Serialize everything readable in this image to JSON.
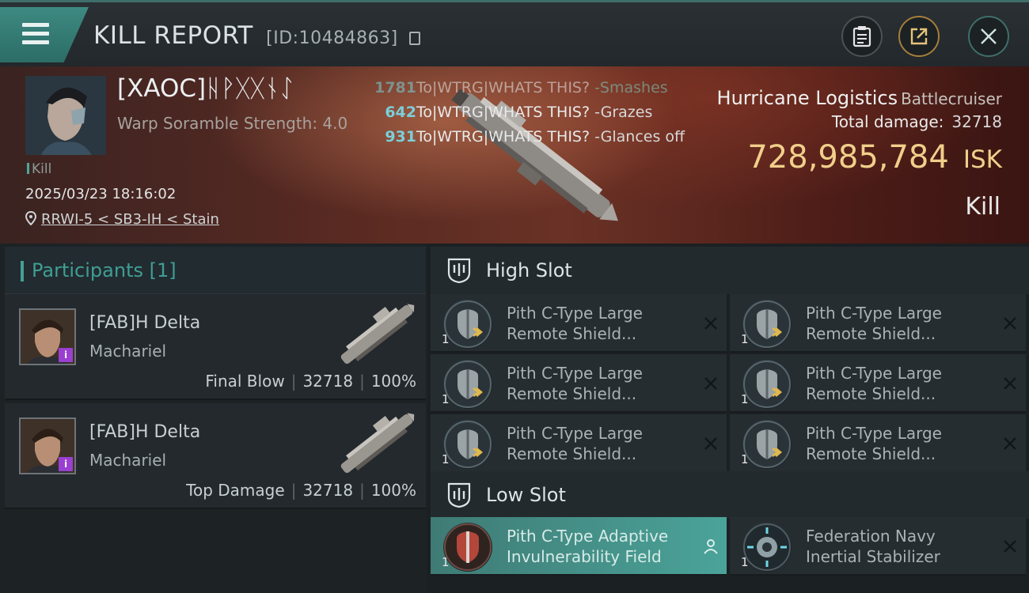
{
  "header": {
    "title": "KILL REPORT",
    "report_id": "[ID:10484863]"
  },
  "victim": {
    "name": "[XAOC]ᚺᚹᚷᚷᚾᛇ",
    "stat": "Warp Soramble Strength: 4.0",
    "kill_tag": "Kill",
    "time": "2025/03/23 18:16:02",
    "location": "RRWI-5 < SB3-IH < Stain",
    "ship": "Hurricane Logistics",
    "ship_class": "Battlecruiser",
    "total_damage_label": "Total damage:",
    "total_damage": "32718",
    "isk_value": "728,985,784",
    "isk_unit": "ISK",
    "result": "Kill"
  },
  "hits": [
    {
      "dmg": "1781",
      "to": "To|WTRG|WHATS THIS?",
      "verb": "-Smashes"
    },
    {
      "dmg": "642",
      "to": "To|WTRG|WHATS THIS?",
      "verb": "-Grazes"
    },
    {
      "dmg": "931",
      "to": "To|WTRG|WHATS THIS?",
      "verb": "-Glances off"
    }
  ],
  "participants": {
    "title": "Participants [1]",
    "rows": [
      {
        "name": "[FAB]H Delta",
        "ship": "Machariel",
        "role": "Final Blow",
        "damage": "32718",
        "percent": "100%",
        "badge": "i"
      },
      {
        "name": "[FAB]H Delta",
        "ship": "Machariel",
        "role": "Top Damage",
        "damage": "32718",
        "percent": "100%",
        "badge": "i"
      }
    ]
  },
  "fitting": {
    "high_slot": {
      "title": "High Slot",
      "modules": [
        {
          "name": "Pith C-Type Large Remote Shield...",
          "qty": "1"
        },
        {
          "name": "Pith C-Type Large Remote Shield...",
          "qty": "1"
        },
        {
          "name": "Pith C-Type Large Remote Shield...",
          "qty": "1"
        },
        {
          "name": "Pith C-Type Large Remote Shield...",
          "qty": "1"
        },
        {
          "name": "Pith C-Type Large Remote Shield...",
          "qty": "1"
        },
        {
          "name": "Pith C-Type Large Remote Shield...",
          "qty": "1"
        }
      ]
    },
    "low_slot": {
      "title": "Low Slot",
      "modules": [
        {
          "name": "Pith C-Type Adaptive Invulnerability Field",
          "qty": "1",
          "state": "active"
        },
        {
          "name": "Federation Navy Inertial Stabilizer",
          "qty": "1"
        }
      ]
    }
  },
  "colors": {
    "accent": "#45a095",
    "isk": "#f1cf8b",
    "damage_number": "#7bcfd9",
    "active_module": "#4aa399"
  }
}
